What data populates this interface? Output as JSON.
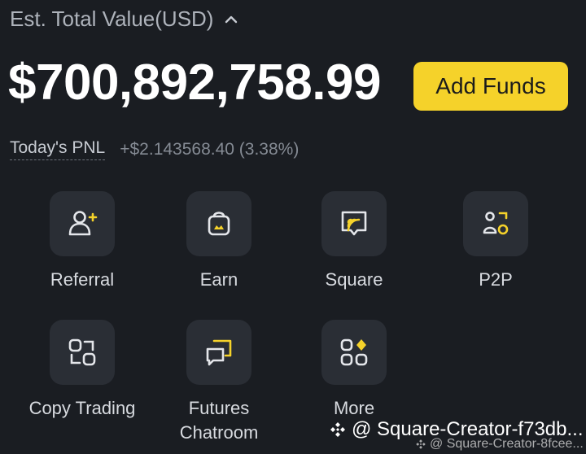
{
  "header": {
    "est_label": "Est. Total Value(USD)",
    "chevron_icon": "chevron-up-icon"
  },
  "balance": {
    "value": "$700,892,758.99"
  },
  "add_funds": {
    "label": "Add Funds"
  },
  "pnl": {
    "label": "Today's PNL",
    "value": "+$2.143568.40 (3.38%)"
  },
  "shortcuts": [
    {
      "label": "Referral",
      "icon": "referral-icon"
    },
    {
      "label": "Earn",
      "icon": "earn-icon"
    },
    {
      "label": "Square",
      "icon": "square-icon"
    },
    {
      "label": "P2P",
      "icon": "p2p-icon"
    },
    {
      "label": "Copy Trading",
      "icon": "copy-trading-icon"
    },
    {
      "label": "Futures Chatroom",
      "icon": "futures-chatroom-icon"
    },
    {
      "label": "More",
      "icon": "more-icon"
    }
  ],
  "watermark": {
    "text": "@ Square-Creator-f73db...",
    "text2": "@ Square-Creator-8fcee..."
  },
  "colors": {
    "background": "#1a1d22",
    "accent": "#f5d22a",
    "tile_bg": "#2a2e35"
  }
}
